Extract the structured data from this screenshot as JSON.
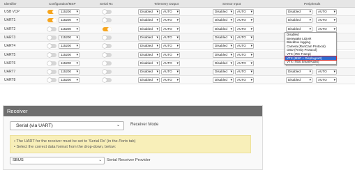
{
  "header": {
    "identifier": "Identifier",
    "config": "Configuration/MSP",
    "serial_rx": "Serial Rx",
    "telemetry": "Telemetry Output",
    "sensor": "Sensor Input",
    "peripherals": "Peripherals"
  },
  "rows": [
    {
      "id": "USB VCP",
      "msp": true,
      "baud": "115200",
      "rx": false,
      "tel": "Disabled",
      "tel_baud": "AUTO",
      "sen": "Disabled",
      "sen_baud": "AUTO",
      "per": "Disabled",
      "per_baud": "AUTO"
    },
    {
      "id": "UART1",
      "msp": true,
      "baud": "115200",
      "rx": false,
      "tel": "Disabled",
      "tel_baud": "AUTO",
      "sen": "Disabled",
      "sen_baud": "AUTO",
      "per": "Disabled",
      "per_baud": "AUTO"
    },
    {
      "id": "UART2",
      "msp": false,
      "baud": "115200",
      "rx": true,
      "tel": "Disabled",
      "tel_baud": "AUTO",
      "sen": "Disabled",
      "sen_baud": "AUTO",
      "per": "Disabled",
      "per_baud": "AUTO"
    },
    {
      "id": "UART3",
      "msp": false,
      "baud": "115200",
      "rx": false,
      "tel": "Disabled",
      "tel_baud": "AUTO",
      "sen": "Disabled",
      "sen_baud": "AUTO",
      "per": "Disabled",
      "per_baud": "AUTO"
    },
    {
      "id": "UART4",
      "msp": false,
      "baud": "115200",
      "rx": false,
      "tel": "Disabled",
      "tel_baud": "AUTO",
      "sen": "Disabled",
      "sen_baud": "AUTO",
      "per": "Disabled",
      "per_baud": "AUTO"
    },
    {
      "id": "UART5",
      "msp": false,
      "baud": "115200",
      "rx": false,
      "tel": "Disabled",
      "tel_baud": "AUTO",
      "sen": "Disabled",
      "sen_baud": "AUTO",
      "per": "Disabled",
      "per_baud": "AUTO"
    },
    {
      "id": "UART6",
      "msp": false,
      "baud": "115200",
      "rx": false,
      "tel": "Disabled",
      "tel_baud": "AUTO",
      "sen": "Disabled",
      "sen_baud": "AUTO",
      "per": "Disabled",
      "per_baud": "AUTO"
    },
    {
      "id": "UART7",
      "msp": false,
      "baud": "115200",
      "rx": false,
      "tel": "Disabled",
      "tel_baud": "AUTO",
      "sen": "Disabled",
      "sen_baud": "AUTO",
      "per": "Disabled",
      "per_baud": "AUTO"
    },
    {
      "id": "UART8",
      "msp": false,
      "baud": "115200",
      "rx": false,
      "tel": "Disabled",
      "tel_baud": "AUTO",
      "sen": "Disabled",
      "sen_baud": "AUTO",
      "per": "Disabled",
      "per_baud": "AUTO"
    }
  ],
  "peripherals_dropdown": {
    "options": [
      "Disabled",
      "Benewake LIDAR",
      "Blackbox logging",
      "Camera (RunCam Protocol)",
      "OSD (FrSky Protocol)",
      "VTX (IRC Tramp)",
      "VTX (MSP + Displayport)",
      "VTX (TBS SmartAudio)"
    ],
    "highlighted_index": 6
  },
  "receiver": {
    "title": "Receiver",
    "mode_value": "Serial (via UART)",
    "mode_label": "Receiver Mode",
    "note_line1_a": "• The UART for the receiver must be set to 'Serial Rx' (in the ",
    "note_line1_ports": "Ports",
    "note_line1_b": " tab)",
    "note_line2": "• Select the correct data format from the drop-down, below:",
    "provider_value": "SBUS",
    "provider_label": "Serial Receiver Provider"
  },
  "colors": {
    "accent": "#f6a51f",
    "highlight": "#2f6ad0",
    "header_bar": "#6e6e6e",
    "note_bg": "#f8efb9"
  }
}
